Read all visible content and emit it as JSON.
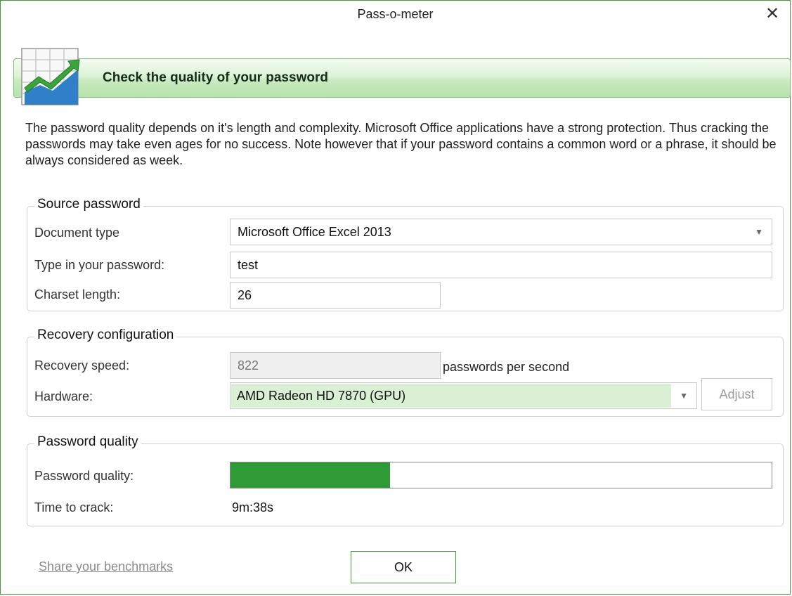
{
  "window": {
    "title": "Pass-o-meter",
    "close_glyph": "✕"
  },
  "banner": {
    "title": "Check the quality of your password",
    "icon": "chart-icon"
  },
  "intro": "The password quality depends on it's length and complexity. Microsoft Office applications have a strong protection. Thus cracking the passwords may take even ages for no success. Note however that if your password contains a common word or a phrase, it should be always considered as week.",
  "source": {
    "legend": "Source password",
    "doc_type_label": "Document type",
    "doc_type_value": "Microsoft Office Excel 2013",
    "password_label": "Type in your password:",
    "password_value": "test",
    "charset_label": "Charset length:",
    "charset_value": "26"
  },
  "recovery": {
    "legend": "Recovery configuration",
    "speed_label": "Recovery speed:",
    "speed_value": "822",
    "speed_unit": "passwords per second",
    "hardware_label": "Hardware:",
    "hardware_value": "AMD Radeon HD 7870 (GPU)",
    "adjust_label": "Adjust"
  },
  "quality": {
    "legend": "Password quality",
    "quality_label": "Password quality:",
    "quality_fraction": 0.295,
    "time_label": "Time to crack:",
    "time_value": "9m:38s"
  },
  "footer": {
    "share_link": "Share your benchmarks",
    "ok_label": "OK"
  },
  "colors": {
    "accent": "#2e9b36",
    "banner_border": "#7fbf74",
    "hardware_bg": "#daf0d5"
  }
}
